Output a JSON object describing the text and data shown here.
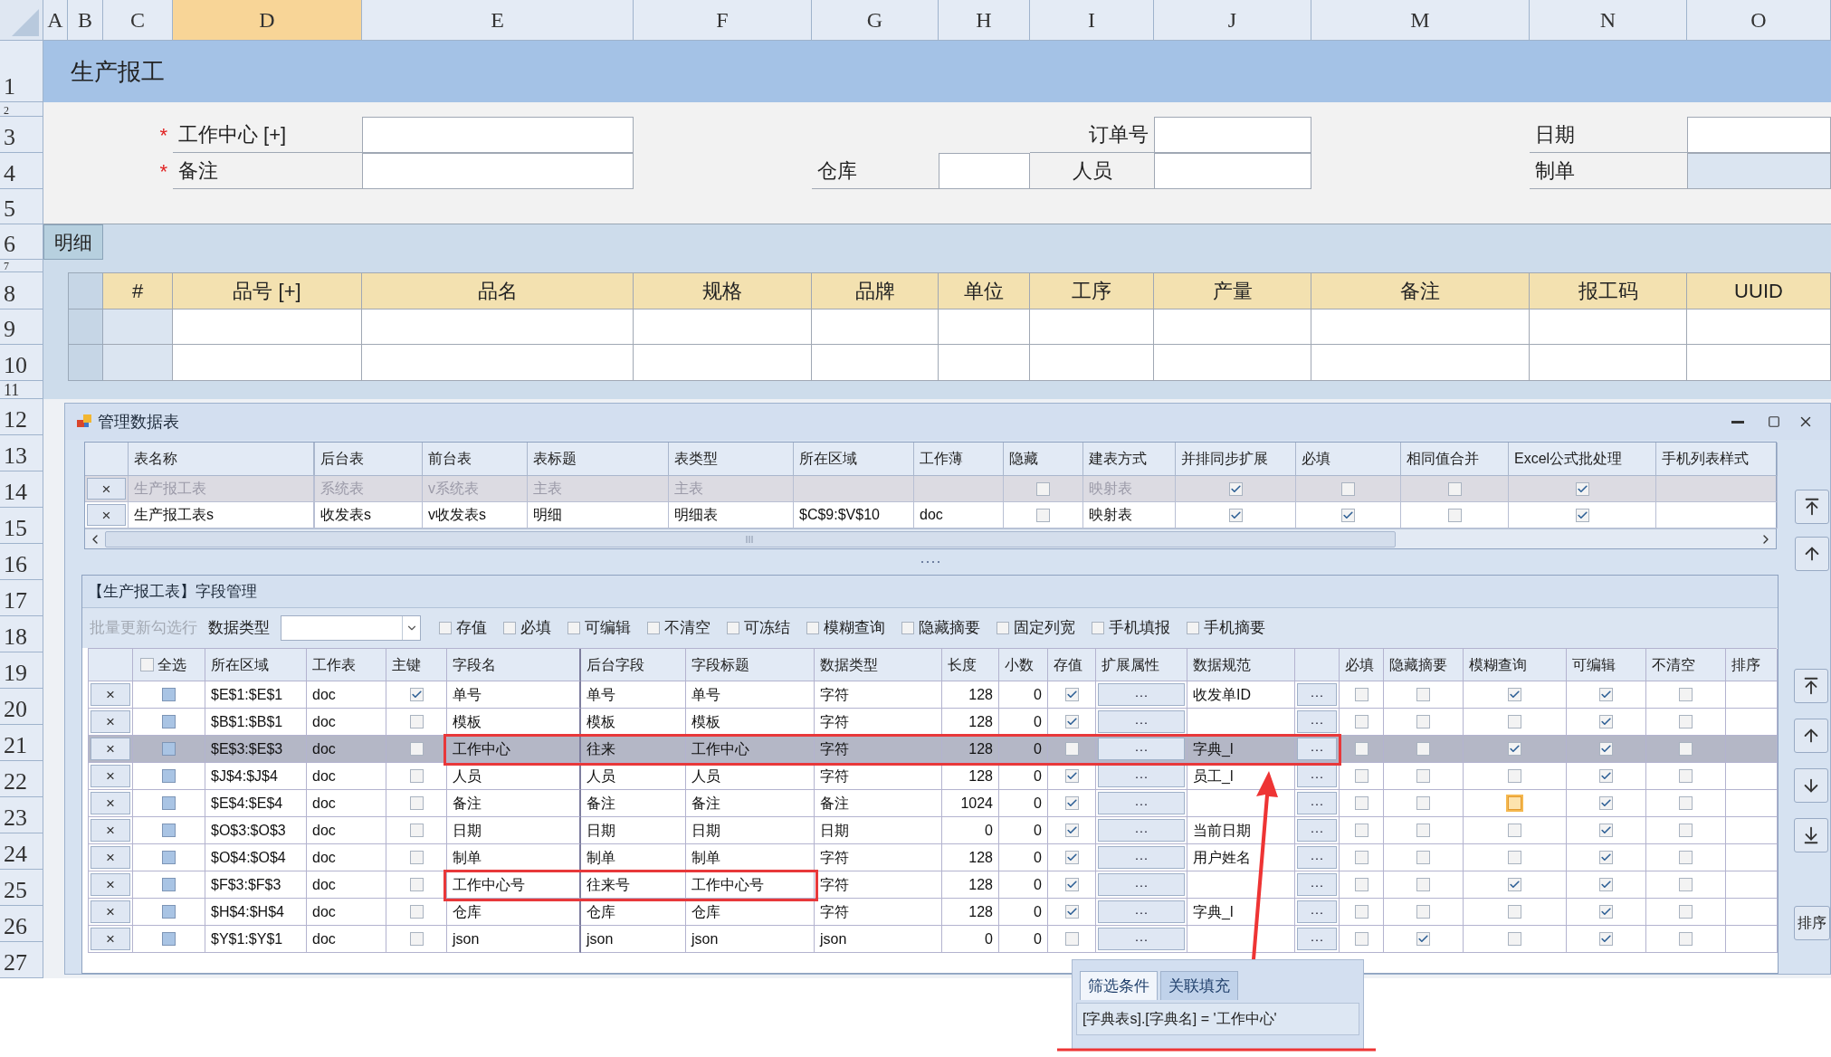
{
  "sheet": {
    "columns": [
      {
        "label": "A",
        "selected": false
      },
      {
        "label": "B",
        "selected": false
      },
      {
        "label": "C",
        "selected": false
      },
      {
        "label": "D",
        "selected": true
      },
      {
        "label": "E",
        "selected": false
      },
      {
        "label": "F",
        "selected": false
      },
      {
        "label": "G",
        "selected": false
      },
      {
        "label": "H",
        "selected": false
      },
      {
        "label": "I",
        "selected": false
      },
      {
        "label": "J",
        "selected": false
      },
      {
        "label": "M",
        "selected": false
      },
      {
        "label": "N",
        "selected": false
      },
      {
        "label": "O",
        "selected": false
      }
    ],
    "rows": [
      "1",
      "2",
      "3",
      "4",
      "5",
      "6",
      "7",
      "8",
      "9",
      "10",
      "11",
      "12",
      "13",
      "14",
      "15",
      "16",
      "17",
      "18",
      "19",
      "20",
      "21",
      "22",
      "23",
      "24",
      "25",
      "26",
      "27"
    ]
  },
  "header": {
    "title": "生产报工"
  },
  "form": {
    "fields": [
      {
        "label": "工作中心 [+]",
        "required_mark": "*",
        "readonly": false
      },
      {
        "label": "订单号",
        "readonly": false
      },
      {
        "label": "日期",
        "readonly": false
      },
      {
        "label": "备注",
        "required_mark": "*",
        "readonly": false
      },
      {
        "label": "仓库",
        "readonly": false
      },
      {
        "label": "人员",
        "readonly": false
      },
      {
        "label": "制单",
        "readonly": true
      }
    ]
  },
  "detail": {
    "tab": "明细",
    "columns": [
      "#",
      "品号 [+]",
      "品名",
      "规格",
      "品牌",
      "单位",
      "工序",
      "产量",
      "备注",
      "报工码",
      "UUID"
    ]
  },
  "dialog": {
    "title": "管理数据表",
    "tables": {
      "columns": [
        "表名称",
        "后台表",
        "前台表",
        "表标题",
        "表类型",
        "所在区域",
        "工作薄",
        "隐藏",
        "建表方式",
        "并排同步扩展",
        "必填",
        "相同值合并",
        "Excel公式批处理",
        "手机列表样式"
      ],
      "rows": [
        {
          "delete": "×",
          "name": "生产报工表",
          "backend": "系统表",
          "frontend": "v系统表",
          "caption": "主表",
          "type": "主表",
          "hidden": false,
          "build": "映射表",
          "sync_expand": true,
          "required": false,
          "merge_same": false,
          "excel_batch": true,
          "disabled": true
        },
        {
          "delete": "×",
          "name": "生产报工表s",
          "backend": "收发表s",
          "frontend": "v收发表s",
          "caption": "明细",
          "type": "明细表",
          "range": "$C$9:$V$10",
          "workbook": "doc",
          "hidden": false,
          "build": "映射表",
          "sync_expand": true,
          "required": true,
          "merge_same": false,
          "excel_batch": true,
          "disabled": false
        }
      ]
    },
    "field_panel": {
      "title": "【生产报工表】字段管理",
      "toolbar": {
        "batch_button": "批量更新勾选行",
        "batch_disabled": true,
        "type_label": "数据类型",
        "checks": [
          {
            "label": "存值",
            "checked": false
          },
          {
            "label": "必填",
            "checked": false
          },
          {
            "label": "可编辑",
            "checked": false
          },
          {
            "label": "不清空",
            "checked": false
          },
          {
            "label": "可冻结",
            "checked": false
          },
          {
            "label": "模糊查询",
            "checked": false
          },
          {
            "label": "隐藏摘要",
            "checked": false
          },
          {
            "label": "固定列宽",
            "checked": false
          },
          {
            "label": "手机填报",
            "checked": false
          },
          {
            "label": "手机摘要",
            "checked": false
          }
        ]
      },
      "select_all_checked": false,
      "columns": [
        "全选",
        "所在区域",
        "工作表",
        "主键",
        "字段名",
        "后台字段",
        "字段标题",
        "数据类型",
        "长度",
        "小数",
        "存值",
        "扩展属性",
        "数据规范",
        "必填",
        "隐藏摘要",
        "模糊查询",
        "可编辑",
        "不清空",
        "排序"
      ],
      "rows": [
        {
          "delete": "×",
          "range": "$E$1:$E$1",
          "sheet": "doc",
          "key": true,
          "field": "单号",
          "backend": "单号",
          "caption": "单号",
          "type": "字符",
          "length": "128",
          "decimals": "0",
          "store": true,
          "ext": "···",
          "spec": "收发单ID",
          "spec_btn": "···",
          "required": false,
          "hide_summary": false,
          "fuzzy": true,
          "fuzzy_focused": false,
          "editable": true,
          "keep": false,
          "selected": false
        },
        {
          "delete": "×",
          "range": "$B$1:$B$1",
          "sheet": "doc",
          "key": false,
          "field": "模板",
          "backend": "模板",
          "caption": "模板",
          "type": "字符",
          "length": "128",
          "decimals": "0",
          "store": true,
          "ext": "···",
          "spec_btn": "···",
          "required": false,
          "hide_summary": false,
          "fuzzy": false,
          "fuzzy_focused": false,
          "editable": true,
          "keep": false,
          "selected": false
        },
        {
          "delete": "×",
          "range": "$E$3:$E$3",
          "sheet": "doc",
          "key": false,
          "field": "工作中心",
          "backend": "往来",
          "caption": "工作中心",
          "type": "字符",
          "length": "128",
          "decimals": "0",
          "store": false,
          "ext": "···",
          "spec": "字典_l",
          "spec_btn": "···",
          "required": false,
          "hide_summary": false,
          "fuzzy": true,
          "fuzzy_focused": false,
          "editable": true,
          "keep": false,
          "selected": true
        },
        {
          "delete": "×",
          "range": "$J$4:$J$4",
          "sheet": "doc",
          "key": false,
          "field": "人员",
          "backend": "人员",
          "caption": "人员",
          "type": "字符",
          "length": "128",
          "decimals": "0",
          "store": true,
          "ext": "···",
          "spec": "员工_l",
          "spec_btn": "···",
          "required": false,
          "hide_summary": false,
          "fuzzy": false,
          "fuzzy_focused": false,
          "editable": true,
          "keep": false,
          "selected": false
        },
        {
          "delete": "×",
          "range": "$E$4:$E$4",
          "sheet": "doc",
          "key": false,
          "field": "备注",
          "backend": "备注",
          "caption": "备注",
          "type": "备注",
          "length": "1024",
          "decimals": "0",
          "store": true,
          "ext": "···",
          "spec_btn": "···",
          "required": false,
          "hide_summary": false,
          "fuzzy": false,
          "fuzzy_focused": true,
          "editable": true,
          "keep": false,
          "selected": false
        },
        {
          "delete": "×",
          "range": "$O$3:$O$3",
          "sheet": "doc",
          "key": false,
          "field": "日期",
          "backend": "日期",
          "caption": "日期",
          "type": "日期",
          "length": "0",
          "decimals": "0",
          "store": true,
          "ext": "···",
          "spec": "当前日期",
          "spec_btn": "···",
          "required": false,
          "hide_summary": false,
          "fuzzy": false,
          "fuzzy_focused": false,
          "editable": true,
          "keep": false,
          "selected": false
        },
        {
          "delete": "×",
          "range": "$O$4:$O$4",
          "sheet": "doc",
          "key": false,
          "field": "制单",
          "backend": "制单",
          "caption": "制单",
          "type": "字符",
          "length": "128",
          "decimals": "0",
          "store": true,
          "ext": "···",
          "spec": "用户姓名",
          "spec_btn": "···",
          "required": false,
          "hide_summary": false,
          "fuzzy": false,
          "fuzzy_focused": false,
          "editable": true,
          "keep": false,
          "selected": false
        },
        {
          "delete": "×",
          "range": "$F$3:$F$3",
          "sheet": "doc",
          "key": false,
          "field": "工作中心号",
          "backend": "往来号",
          "caption": "工作中心号",
          "type": "字符",
          "length": "128",
          "decimals": "0",
          "store": true,
          "ext": "···",
          "spec_btn": "···",
          "required": false,
          "hide_summary": false,
          "fuzzy": true,
          "fuzzy_focused": false,
          "editable": true,
          "keep": false,
          "selected": false
        },
        {
          "delete": "×",
          "range": "$H$4:$H$4",
          "sheet": "doc",
          "key": false,
          "field": "仓库",
          "backend": "仓库",
          "caption": "仓库",
          "type": "字符",
          "length": "128",
          "decimals": "0",
          "store": true,
          "ext": "···",
          "spec": "字典_l",
          "spec_btn": "···",
          "required": false,
          "hide_summary": false,
          "fuzzy": false,
          "fuzzy_focused": false,
          "editable": true,
          "keep": false,
          "selected": false
        },
        {
          "delete": "×",
          "range": "$Y$1:$Y$1",
          "sheet": "doc",
          "key": false,
          "field": "json",
          "backend": "json",
          "caption": "json",
          "type": "json",
          "length": "0",
          "decimals": "0",
          "store": false,
          "ext": "···",
          "spec_btn": "···",
          "required": false,
          "hide_summary": true,
          "fuzzy": false,
          "fuzzy_focused": false,
          "editable": true,
          "keep": false,
          "selected": false
        }
      ],
      "sort_button": "排序"
    }
  },
  "popup": {
    "tabs": [
      {
        "label": "筛选条件",
        "selected": true
      },
      {
        "label": "关联填充",
        "selected": false
      }
    ],
    "expression": "[字典表s].[字典名] = '工作中心'"
  }
}
